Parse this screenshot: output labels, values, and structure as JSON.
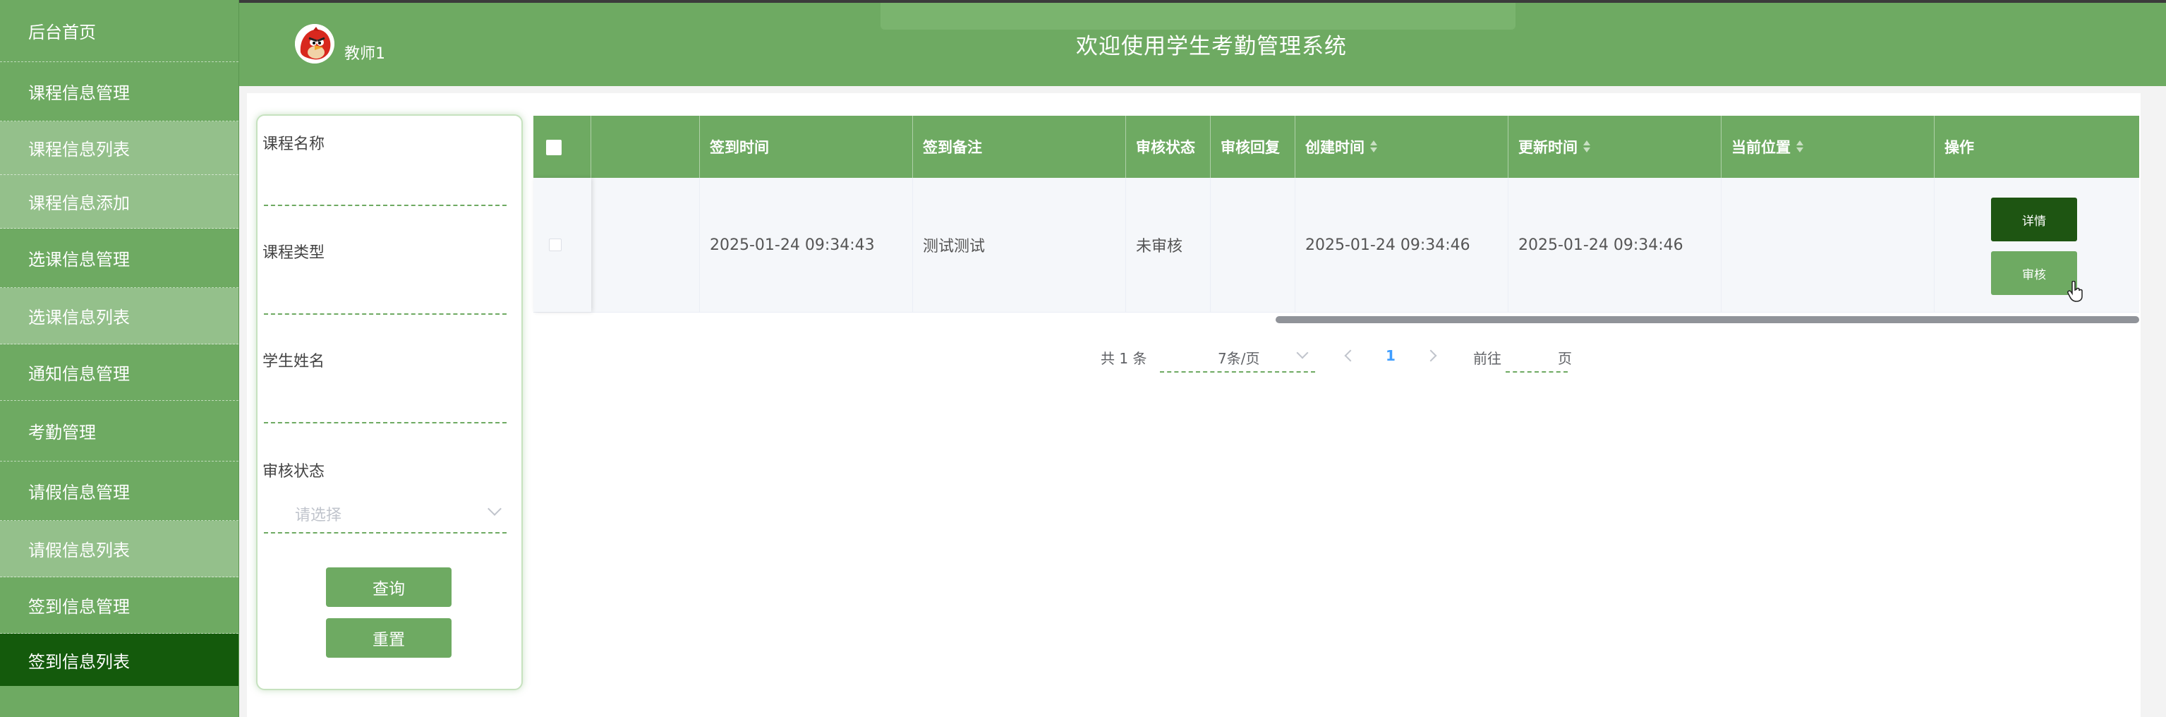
{
  "header": {
    "title": "欢迎使用学生考勤管理系统",
    "username": "教师1"
  },
  "sidebar": {
    "items": [
      {
        "label": "后台首页",
        "type": "top"
      },
      {
        "label": "课程信息管理",
        "type": "top"
      },
      {
        "label": "课程信息列表",
        "type": "sub"
      },
      {
        "label": "课程信息添加",
        "type": "sub"
      },
      {
        "label": "选课信息管理",
        "type": "top"
      },
      {
        "label": "选课信息列表",
        "type": "sub"
      },
      {
        "label": "通知信息管理",
        "type": "top"
      },
      {
        "label": "考勤管理",
        "type": "top"
      },
      {
        "label": "请假信息管理",
        "type": "top"
      },
      {
        "label": "请假信息列表",
        "type": "sub"
      },
      {
        "label": "签到信息管理",
        "type": "top"
      },
      {
        "label": "签到信息列表",
        "type": "active"
      }
    ]
  },
  "search": {
    "course_name_label": "课程名称",
    "course_type_label": "课程类型",
    "student_name_label": "学生姓名",
    "audit_status_label": "审核状态",
    "audit_status_placeholder": "请选择",
    "query_button": "查询",
    "reset_button": "重置"
  },
  "table": {
    "columns": [
      "",
      "",
      "签到时间",
      "签到备注",
      "审核状态",
      "审核回复",
      "创建时间",
      "更新时间",
      "当前位置",
      "操作"
    ],
    "rows": [
      {
        "sign_time": "2025-01-24 09:34:43",
        "sign_note": "测试测试",
        "audit_status": "未审核",
        "audit_reply": "",
        "created_at": "2025-01-24 09:34:46",
        "updated_at": "2025-01-24 09:34:46",
        "location": "",
        "detail_button": "详情",
        "audit_button": "审核"
      }
    ]
  },
  "pagination": {
    "total": "共 1 条",
    "page_size": "7条/页",
    "current_page": "1",
    "goto_label": "前往",
    "page_suffix": "页"
  },
  "colors": {
    "theme_green": "#6eaa62",
    "active_dark_green": "#145a0c",
    "detail_button": "#1e5512",
    "page_active": "#409eff"
  }
}
